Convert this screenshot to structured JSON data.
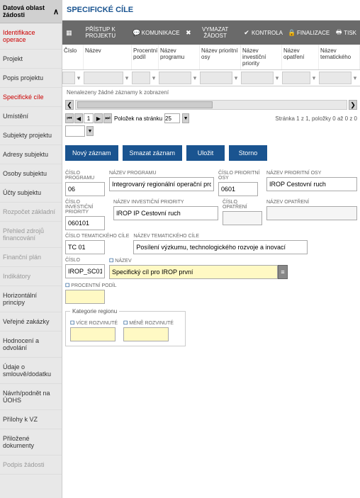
{
  "sidebar": {
    "header": "Datová oblast žádosti",
    "items": [
      {
        "label": "Identifikace operace",
        "cls": "active"
      },
      {
        "label": "Projekt",
        "cls": ""
      },
      {
        "label": "Popis projektu",
        "cls": ""
      },
      {
        "label": "Specifické cíle",
        "cls": "highlight"
      },
      {
        "label": "Umístění",
        "cls": ""
      },
      {
        "label": "Subjekty projektu",
        "cls": ""
      },
      {
        "label": "Adresy subjektu",
        "cls": ""
      },
      {
        "label": "Osoby subjektu",
        "cls": ""
      },
      {
        "label": "Účty subjektu",
        "cls": ""
      },
      {
        "label": "Rozpočet základní",
        "cls": "disabled"
      },
      {
        "label": "Přehled zdrojů financování",
        "cls": "disabled"
      },
      {
        "label": "Finanční plán",
        "cls": "disabled"
      },
      {
        "label": "Indikátory",
        "cls": "disabled"
      },
      {
        "label": "Horizontální principy",
        "cls": ""
      },
      {
        "label": "Veřejné zakázky",
        "cls": ""
      },
      {
        "label": "Hodnocení a odvolání",
        "cls": ""
      },
      {
        "label": "Údaje o smlouvě/dodatku",
        "cls": ""
      },
      {
        "label": "Návrh/podnět na ÚOHS",
        "cls": ""
      },
      {
        "label": "Přílohy k VZ",
        "cls": ""
      },
      {
        "label": "Přiložené dokumenty",
        "cls": ""
      },
      {
        "label": "Podpis žádosti",
        "cls": "disabled"
      }
    ]
  },
  "page_title": "SPECIFICKÉ CÍLE",
  "toolbar": {
    "access": "PŘÍSTUP K PROJEKTU",
    "comm": "KOMUNIKACE",
    "cancel_req": "VYMAZAT ŽÁDOST",
    "check": "KONTROLA",
    "finalize": "FINALIZACE",
    "print": "TISK"
  },
  "grid": {
    "cols": [
      "Číslo",
      "Název",
      "Procentní podíl",
      "Název programu",
      "Název prioritní osy",
      "Název investiční priority",
      "Název opatření",
      "Název tematického"
    ],
    "no_records": "Nenalezeny žádné záznamy k zobrazení",
    "page_value": "1",
    "page_label": "Položek na stránku",
    "page_size": "25",
    "pager_info": "Stránka 1 z 1, položky 0 až 0 z 0"
  },
  "actions": {
    "new": "Nový záznam",
    "delete": "Smazat záznam",
    "save": "Uložit",
    "cancel": "Storno"
  },
  "form": {
    "cislo_programu_lbl": "ČÍSLO PROGRAMU",
    "cislo_programu": "06",
    "nazev_programu_lbl": "NÁZEV PROGRAMU",
    "nazev_programu": "Integrovaný regionální operační program",
    "cislo_pos_lbl": "ČÍSLO PRIORITNÍ OSY",
    "cislo_pos": "0601",
    "nazev_pos_lbl": "NÁZEV PRIORITNÍ OSY",
    "nazev_pos": "IROP Cestovní ruch",
    "cislo_ip_lbl": "ČÍSLO INVESTIČNÍ PRIORITY",
    "cislo_ip": "060101",
    "nazev_ip_lbl": "NÁZEV INVESTIČNÍ PRIORITY",
    "nazev_ip": "IROP IP Cestovní ruch",
    "cislo_op_lbl": "ČÍSLO OPATŘENÍ",
    "cislo_op": "",
    "nazev_op_lbl": "NÁZEV OPATŘENÍ",
    "nazev_op": "",
    "cislo_tc_lbl": "ČÍSLO TEMATICKÉHO CÍLE",
    "cislo_tc": "TC 01",
    "nazev_tc_lbl": "NÁZEV TEMATICKÉHO CÍLE",
    "nazev_tc": "Posílení výzkumu, technologického rozvoje a inovací",
    "cislo_lbl": "ČÍSLO",
    "cislo": "IROP_SC01",
    "nazev_lbl": "NÁZEV",
    "nazev": "Specifický cíl pro IROP první",
    "procentni_lbl": "PROCENTNÍ PODÍL",
    "procentni": "",
    "region_legend": "Kategorie regionu",
    "vice_lbl": "VÍCE ROZVINUTÉ",
    "vice": "",
    "mene_lbl": "MÉNĚ ROZVINUTÉ",
    "mene": ""
  }
}
